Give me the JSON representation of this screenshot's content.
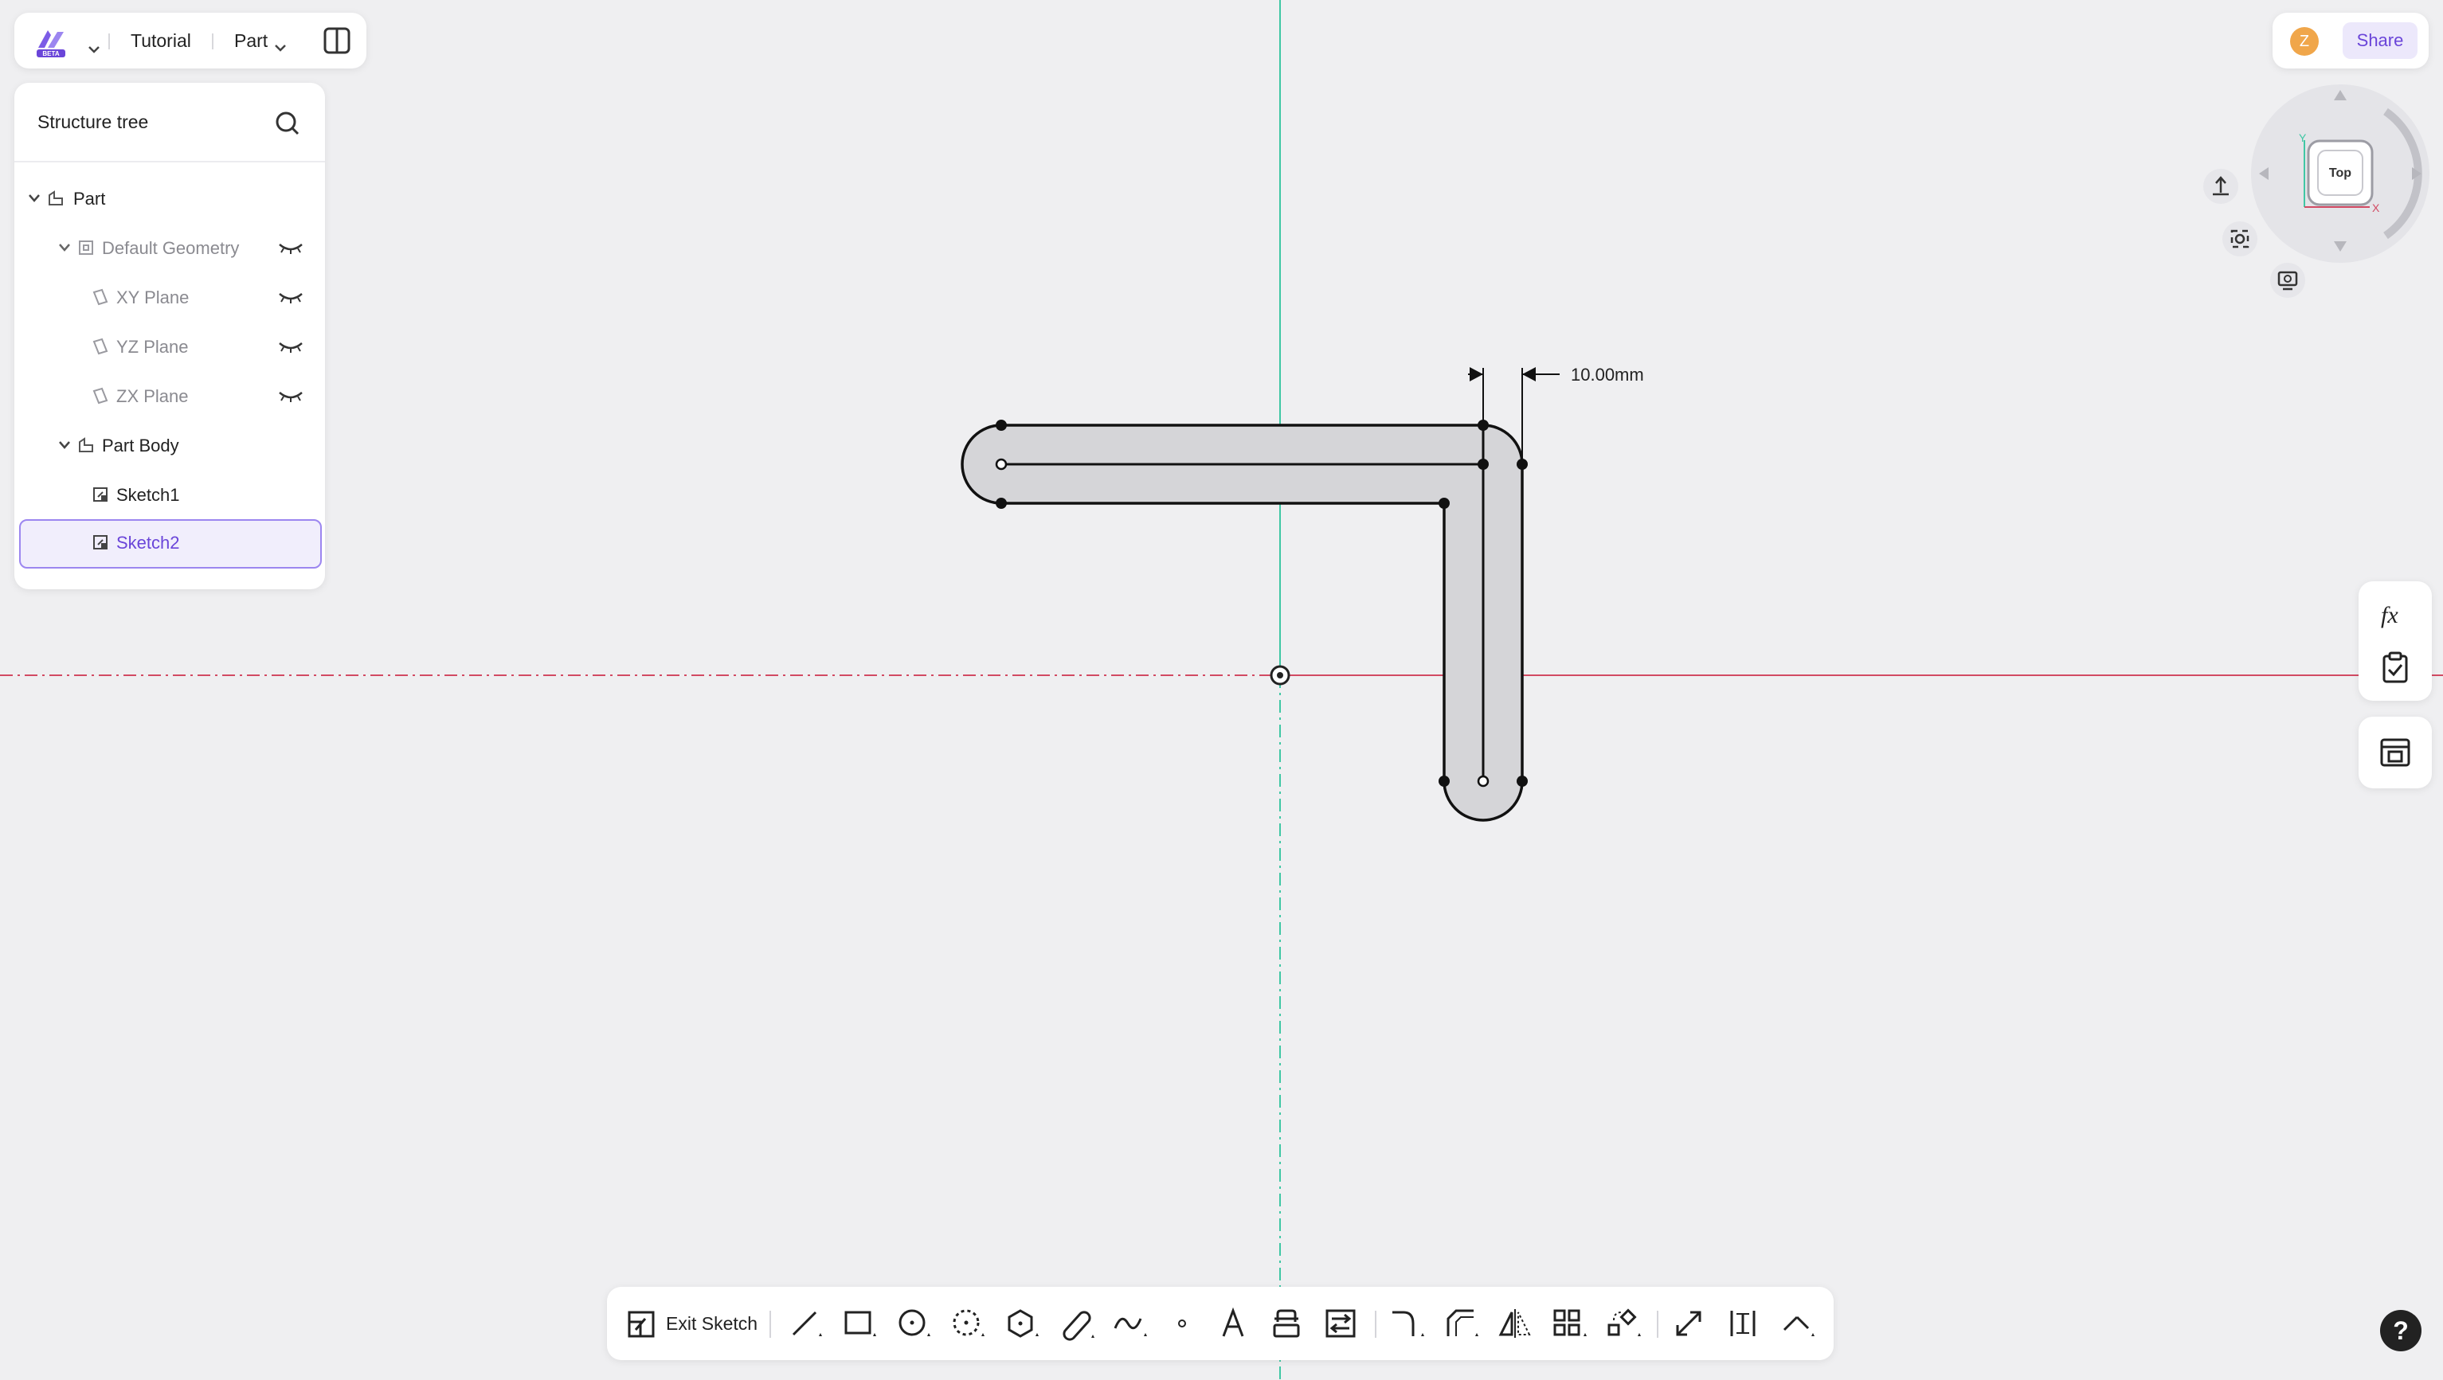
{
  "topbar": {
    "logo_badge": "BETA",
    "project_name": "Tutorial",
    "mode_label": "Part"
  },
  "tree": {
    "title": "Structure tree",
    "items": [
      {
        "label": "Part"
      },
      {
        "label": "Default Geometry"
      },
      {
        "label": "XY Plane"
      },
      {
        "label": "YZ Plane"
      },
      {
        "label": "ZX Plane"
      },
      {
        "label": "Part Body"
      },
      {
        "label": "Sketch1"
      },
      {
        "label": "Sketch2"
      }
    ]
  },
  "header_right": {
    "avatar_initial": "Z",
    "share_label": "Share"
  },
  "view_cube": {
    "face_label": "Top",
    "axis_y": "Y",
    "axis_x": "X"
  },
  "sketch": {
    "dimension": "10.00mm"
  },
  "toolbar": {
    "exit_label": "Exit Sketch",
    "tools": [
      "line-tool",
      "rectangle-tool",
      "circle-tool",
      "arc-tool",
      "polygon-tool",
      "slot-tool",
      "spline-tool",
      "point-tool",
      "text-tool",
      "offset-tool",
      "project-tool",
      "fillet-tool",
      "chamfer-tool",
      "mirror-tool",
      "pattern-tool",
      "transform-tool",
      "extend-tool",
      "dimension-tool",
      "constraint-tool"
    ]
  },
  "right_tools": [
    "formula-icon",
    "checklist-icon",
    "table-icon"
  ],
  "help_label": "?",
  "colors": {
    "accent": "#6a45d9",
    "x_axis": "#d24a63",
    "y_axis": "#3fc7a4",
    "background": "#efeff1"
  }
}
